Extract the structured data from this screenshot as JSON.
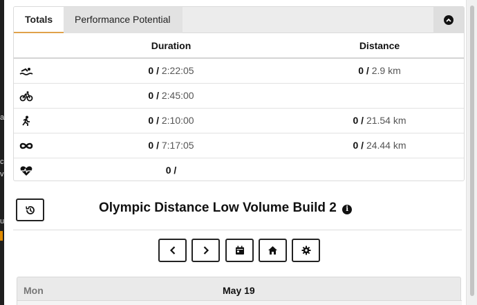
{
  "left_strip_fragments": [
    "a",
    "c",
    "v",
    "u"
  ],
  "tabs": [
    {
      "label": "Totals",
      "active": true
    },
    {
      "label": "Performance Potential",
      "active": false
    }
  ],
  "totals": {
    "headers": {
      "duration": "Duration",
      "distance": "Distance"
    },
    "rows": [
      {
        "icon": "swim-icon",
        "dur_done": "0 /",
        "dur_plan": "2:22:05",
        "dist_done": "0 /",
        "dist_plan": "2.9 km"
      },
      {
        "icon": "bike-icon",
        "dur_done": "0 /",
        "dur_plan": "2:45:00",
        "dist_done": "",
        "dist_plan": ""
      },
      {
        "icon": "run-icon",
        "dur_done": "0 /",
        "dur_plan": "2:10:00",
        "dist_done": "0 /",
        "dist_plan": "21.54 km"
      },
      {
        "icon": "infinity-icon",
        "dur_done": "0 /",
        "dur_plan": "7:17:05",
        "dist_done": "0 /",
        "dist_plan": "24.44 km"
      },
      {
        "icon": "heart-rate-icon",
        "dur_done": "0 /",
        "dur_plan": "",
        "dist_done": "",
        "dist_plan": ""
      }
    ]
  },
  "plan": {
    "title": "Olympic Distance Low Volume Build 2",
    "info_glyph": "i"
  },
  "calendar": {
    "day": "Mon",
    "date": "May 19"
  },
  "colors": {
    "active_tab_underline": "#e0a24a",
    "text": "#111111",
    "muted": "#555555"
  }
}
